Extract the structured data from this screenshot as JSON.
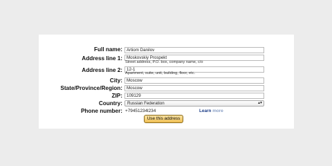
{
  "form": {
    "full_name": {
      "label": "Full name:",
      "value": "Artiom Danilov"
    },
    "address_line_1": {
      "label": "Address line 1:",
      "value": "Moskovskiy Prospekt",
      "hint": "Street address, P.O. box, company name, c/o"
    },
    "address_line_2": {
      "label": "Address line 2:",
      "value": "12-1",
      "hint": "Apartment, suite, unit, building, floor, etc."
    },
    "city": {
      "label": "City:",
      "value": "Moscow"
    },
    "state": {
      "label": "State/Province/Region:",
      "value": "Moscow"
    },
    "zip": {
      "label": "ZIP:",
      "value": "109129"
    },
    "country": {
      "label": "Country:",
      "selected": "Russian Federation"
    },
    "phone": {
      "label": "Phone number:",
      "value": "+79451234l234"
    },
    "learn_more": {
      "first": "Learn",
      "second": "more"
    },
    "submit_label": "Use this address"
  },
  "colors": {
    "page_background": "#ececec",
    "button_top": "#f9e3a4",
    "button_bottom": "#efbe52",
    "link": "#1b3c86"
  }
}
